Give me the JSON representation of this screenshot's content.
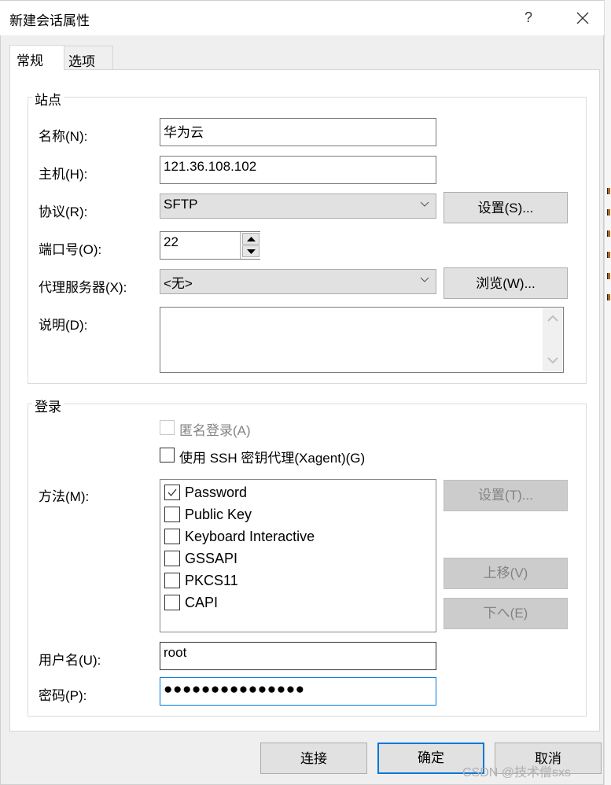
{
  "window": {
    "title": "新建会话属性",
    "help_label": "?",
    "close_icon": "close-icon"
  },
  "tabs": [
    {
      "label": "常规",
      "active": true
    },
    {
      "label": "选项",
      "active": false
    }
  ],
  "site": {
    "title": "站点",
    "name_label": "名称(N):",
    "name_value": "华为云",
    "host_label": "主机(H):",
    "host_value": "121.36.108.102",
    "protocol_label": "协议(R):",
    "protocol_value": "SFTP",
    "protocol_settings_label": "设置(S)...",
    "port_label": "端口号(O):",
    "port_value": "22",
    "proxy_label": "代理服务器(X):",
    "proxy_value": "<无>",
    "browse_label": "浏览(W)...",
    "description_label": "说明(D):",
    "description_value": ""
  },
  "login": {
    "title": "登录",
    "anonymous_label": "匿名登录(A)",
    "anonymous_checked": false,
    "anonymous_enabled": false,
    "agent_label": "使用 SSH 密钥代理(Xagent)(G)",
    "agent_checked": false,
    "method_label": "方法(M):",
    "methods": [
      {
        "label": "Password",
        "checked": true
      },
      {
        "label": "Public Key",
        "checked": false
      },
      {
        "label": "Keyboard Interactive",
        "checked": false
      },
      {
        "label": "GSSAPI",
        "checked": false
      },
      {
        "label": "PKCS11",
        "checked": false
      },
      {
        "label": "CAPI",
        "checked": false
      }
    ],
    "method_settings_label": "设置(T)...",
    "move_up_label": "上移(V)",
    "move_down_label": "下へ(E)",
    "username_label": "用户名(U):",
    "username_value": "root",
    "password_label": "密码(P):",
    "password_value": "●●●●●●●●●●●●●●●"
  },
  "footer": {
    "connect_label": "连接",
    "ok_label": "确定",
    "cancel_label": "取消"
  },
  "watermark": "CSDN @技术僧sxs",
  "colors": {
    "accent": "#0078d7",
    "button_bg": "#e1e1e1",
    "disabled_bg": "#cccccc",
    "dialog_bg": "#efefef"
  }
}
